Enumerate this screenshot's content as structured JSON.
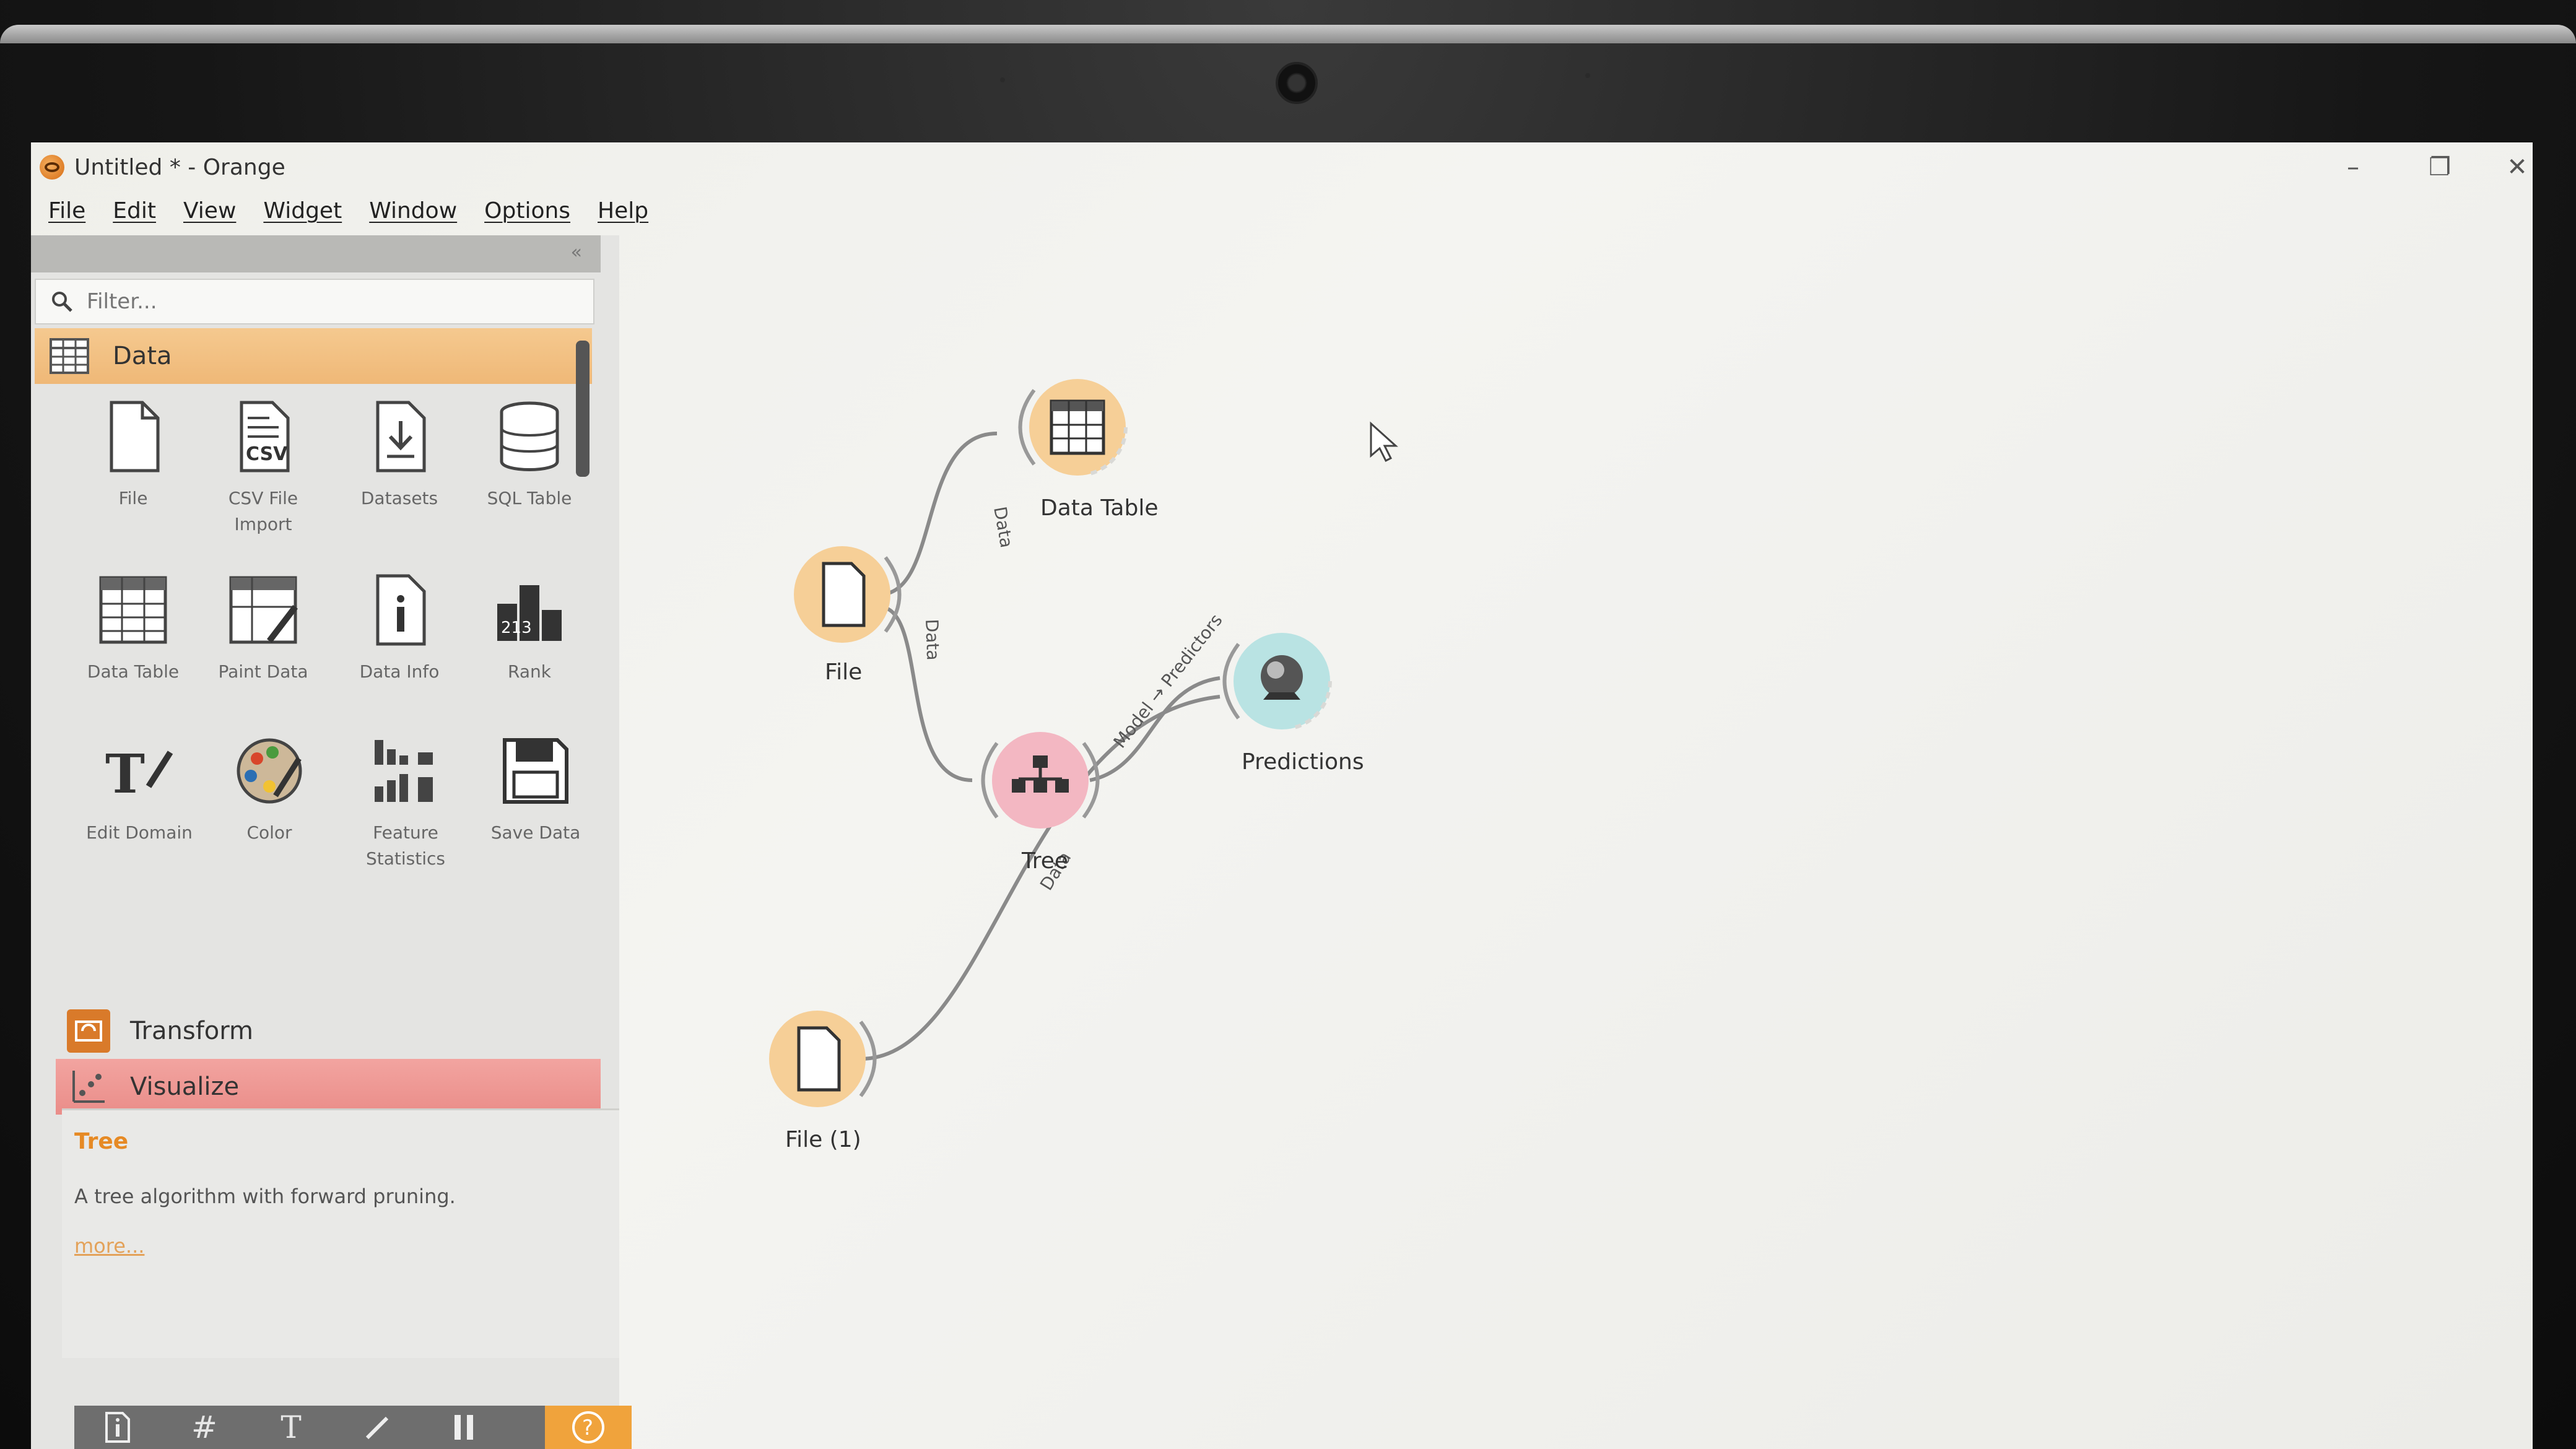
{
  "window": {
    "title": "Untitled * - Orange",
    "controls": {
      "minimize": "–",
      "restore": "❐",
      "close": "✕"
    }
  },
  "menu": [
    "File",
    "Edit",
    "View",
    "Widget",
    "Window",
    "Options",
    "Help"
  ],
  "toolbox": {
    "filter_placeholder": "Filter...",
    "categories": {
      "data": "Data",
      "transform": "Transform",
      "visualize": "Visualize"
    },
    "data_widgets": [
      {
        "label": "File",
        "icon": "file-icon"
      },
      {
        "label": "CSV File Import",
        "icon": "csv-icon"
      },
      {
        "label": "Datasets",
        "icon": "datasets-icon"
      },
      {
        "label": "SQL Table",
        "icon": "database-icon"
      },
      {
        "label": "Data Table",
        "icon": "table-icon"
      },
      {
        "label": "Paint Data",
        "icon": "paint-icon"
      },
      {
        "label": "Data Info",
        "icon": "info-icon"
      },
      {
        "label": "Rank",
        "icon": "rank-icon"
      },
      {
        "label": "Edit Domain",
        "icon": "edit-domain-icon"
      },
      {
        "label": "Color",
        "icon": "palette-icon"
      },
      {
        "label": "Feature Statistics",
        "icon": "statistics-icon"
      },
      {
        "label": "Save Data",
        "icon": "save-icon"
      }
    ],
    "rank_digits": "213"
  },
  "description": {
    "title": "Tree",
    "text": "A tree algorithm with forward pruning.",
    "more": "more..."
  },
  "canvas": {
    "nodes": {
      "data_table": "Data Table",
      "file": "File",
      "tree": "Tree",
      "predictions": "Predictions",
      "file1": "File (1)"
    },
    "links": {
      "file_to_table": "Data",
      "file_to_tree": "Data",
      "tree_to_predictions": "Model → Predictors",
      "file1_to_predictions": "Data"
    }
  },
  "colors": {
    "data_category": "#f5c98f",
    "visualize_category": "#ef9a96",
    "node_data": "#f6cf97",
    "node_model": "#f3b7c2",
    "node_evaluate": "#b9e3e3",
    "help_button": "#f0a33c"
  }
}
